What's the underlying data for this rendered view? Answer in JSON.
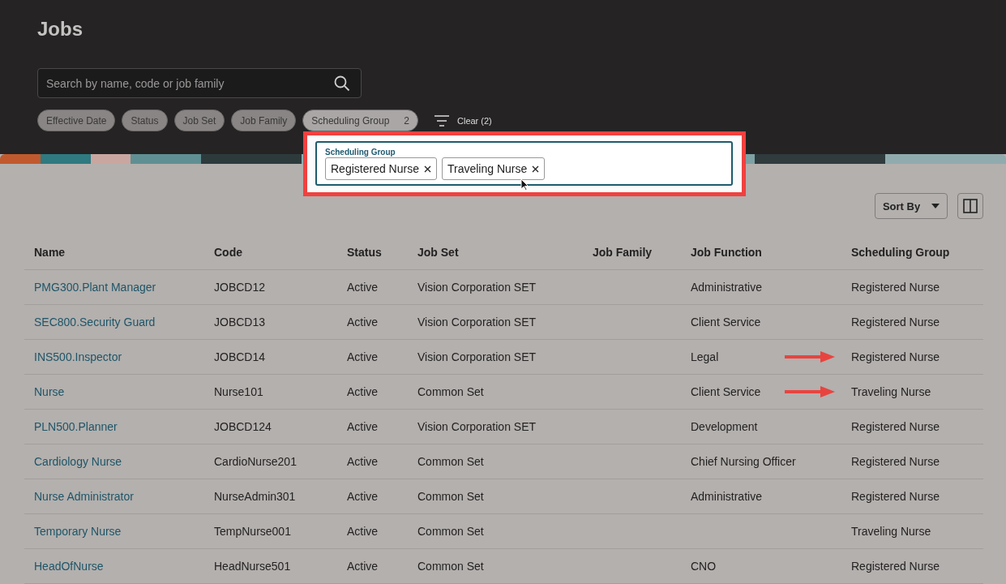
{
  "page": {
    "title": "Jobs"
  },
  "search": {
    "placeholder": "Search by name, code or job family"
  },
  "filters": [
    {
      "label": "Effective Date",
      "active": false
    },
    {
      "label": "Status",
      "active": false
    },
    {
      "label": "Job Set",
      "active": false
    },
    {
      "label": "Job Family",
      "active": false
    },
    {
      "label": "Scheduling Group",
      "count": "2",
      "active": true
    }
  ],
  "clear": {
    "label": "Clear (2)"
  },
  "popup": {
    "label": "Scheduling Group",
    "tokens": [
      "Registered Nurse",
      "Traveling Nurse"
    ]
  },
  "toolbar": {
    "sort_label": "Sort By"
  },
  "table": {
    "columns": [
      "Name",
      "Code",
      "Status",
      "Job Set",
      "Job Family",
      "Job Function",
      "Scheduling Group"
    ],
    "rows": [
      {
        "cells": [
          "PMG300.Plant Manager",
          "JOBCD12",
          "Active",
          "Vision Corporation SET",
          "",
          "Administrative",
          "Registered Nurse"
        ],
        "arrow": false
      },
      {
        "cells": [
          "SEC800.Security Guard",
          "JOBCD13",
          "Active",
          "Vision Corporation SET",
          "",
          "Client Service",
          "Registered Nurse"
        ],
        "arrow": false
      },
      {
        "cells": [
          "INS500.Inspector",
          "JOBCD14",
          "Active",
          "Vision Corporation SET",
          "",
          "Legal",
          "Registered Nurse"
        ],
        "arrow": true
      },
      {
        "cells": [
          "Nurse",
          "Nurse101",
          "Active",
          "Common Set",
          "",
          "Client Service",
          "Traveling Nurse"
        ],
        "arrow": true
      },
      {
        "cells": [
          "PLN500.Planner",
          "JOBCD124",
          "Active",
          "Vision Corporation SET",
          "",
          "Development",
          "Registered Nurse"
        ],
        "arrow": false
      },
      {
        "cells": [
          "Cardiology Nurse",
          "CardioNurse201",
          "Active",
          "Common Set",
          "",
          "Chief Nursing Officer",
          "Registered Nurse"
        ],
        "arrow": false
      },
      {
        "cells": [
          "Nurse Administrator",
          "NurseAdmin301",
          "Active",
          "Common Set",
          "",
          "Administrative",
          "Registered Nurse"
        ],
        "arrow": false
      },
      {
        "cells": [
          "Temporary Nurse",
          "TempNurse001",
          "Active",
          "Common Set",
          "",
          "",
          "Traveling Nurse"
        ],
        "arrow": false
      },
      {
        "cells": [
          "HeadOfNurse",
          "HeadNurse501",
          "Active",
          "Common Set",
          "",
          "CNO",
          "Registered Nurse"
        ],
        "arrow": false
      }
    ]
  }
}
